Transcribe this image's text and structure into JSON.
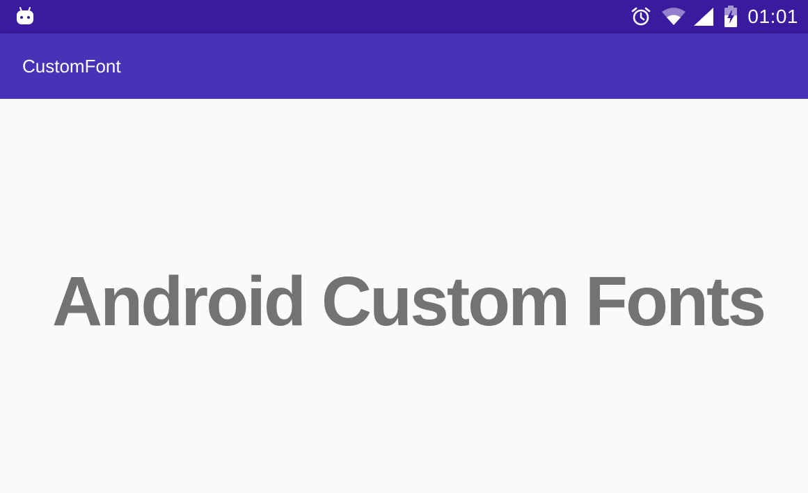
{
  "status_bar": {
    "left_icon": "android-debug-icon",
    "icons": [
      "alarm-clock-icon",
      "wifi-icon",
      "cell-signal-icon",
      "battery-charging-icon"
    ],
    "time": "01:01",
    "background": "#3A1A9E"
  },
  "app_bar": {
    "title": "CustomFont",
    "background": "#4832B6"
  },
  "main": {
    "headline": "Android Custom Fonts",
    "text_color": "#737373",
    "background": "#FAFAFA"
  }
}
